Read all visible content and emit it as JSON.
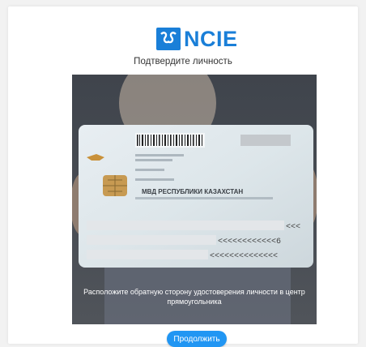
{
  "brand": {
    "name": "NCIE",
    "color": "#1a7fd8",
    "logo_icon": "ncie-logo-icon"
  },
  "page": {
    "title": "Подтвердите личность"
  },
  "camera": {
    "hint": "Расположите обратную сторону удостоверения личности в центр прямоугольника",
    "card_issuer": "МВД РЕСПУБЛИКИ КАЗАХСТАН",
    "mrz_fill_1": "<<<",
    "mrz_fill_2": "<<<<<<<<<<<<6",
    "mrz_fill_3": "<<<<<<<<<<<<<<"
  },
  "actions": {
    "continue_label": "Продолжить",
    "accent": "#2196f3"
  }
}
